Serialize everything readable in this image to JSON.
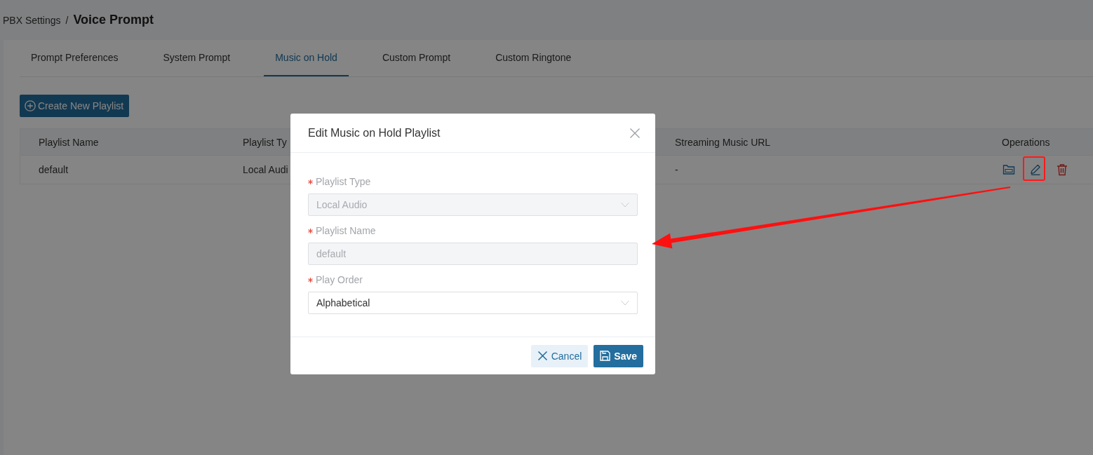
{
  "breadcrumb": {
    "parent": "PBX Settings",
    "separator": "/",
    "current": "Voice Prompt"
  },
  "tabs": [
    {
      "label": "Prompt Preferences",
      "selected": false
    },
    {
      "label": "System Prompt",
      "selected": false
    },
    {
      "label": "Music on Hold",
      "selected": true
    },
    {
      "label": "Custom Prompt",
      "selected": false
    },
    {
      "label": "Custom Ringtone",
      "selected": false
    }
  ],
  "create_button": {
    "label": "Create New Playlist"
  },
  "table": {
    "columns": [
      "Playlist Name",
      "Playlist Ty",
      "Streaming Music URL",
      "Operations"
    ],
    "rows": [
      {
        "cells": [
          "default",
          "Local Audi",
          "-"
        ]
      }
    ]
  },
  "dialog": {
    "title": "Edit Music on Hold Playlist",
    "fields": [
      {
        "label": "Playlist Type",
        "required": true,
        "kind": "select",
        "value": "Local Audio",
        "disabled": true
      },
      {
        "label": "Playlist Name",
        "required": true,
        "kind": "text",
        "value": "default",
        "disabled": true
      },
      {
        "label": "Play Order",
        "required": true,
        "kind": "select",
        "value": "Alphabetical",
        "disabled": false
      }
    ],
    "buttons": [
      {
        "label": "Cancel",
        "kind": "cancel"
      },
      {
        "label": "Save",
        "kind": "save"
      }
    ]
  }
}
